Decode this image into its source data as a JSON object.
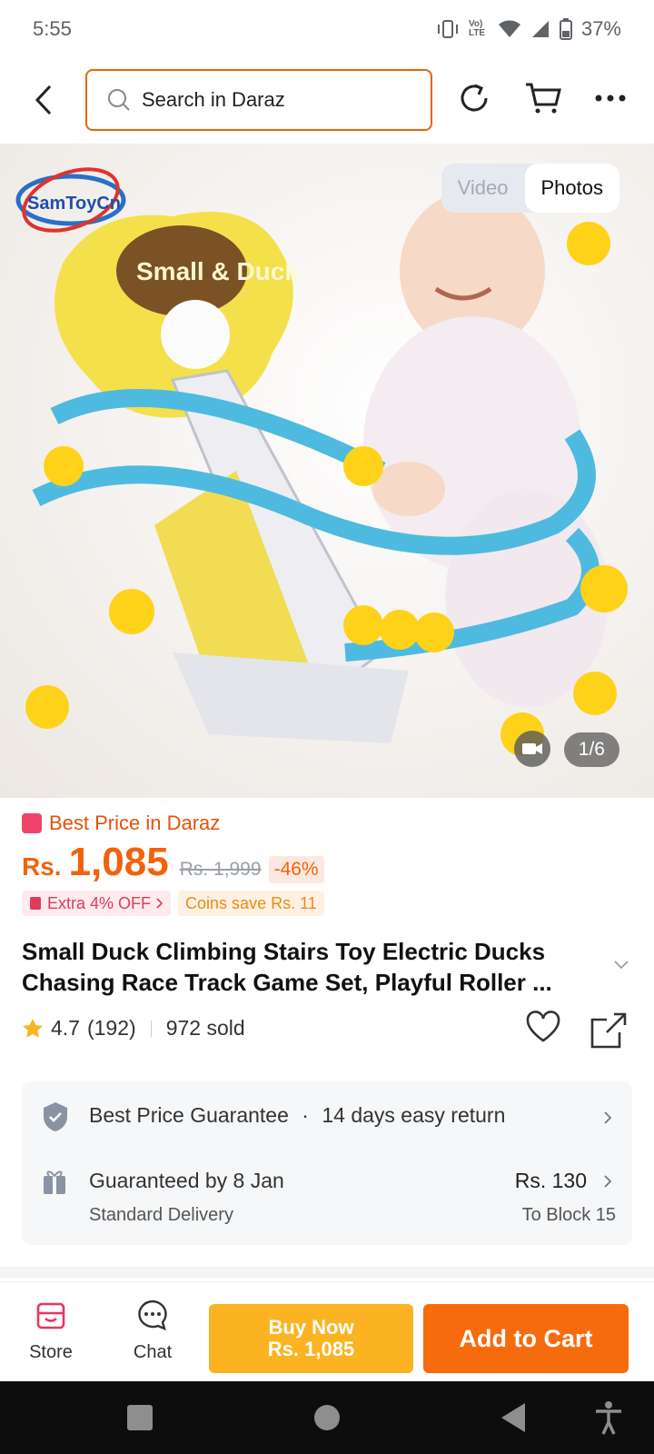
{
  "status": {
    "time": "5:55",
    "battery": "37%",
    "lte_label": "Vo) LTE"
  },
  "header": {
    "search_placeholder": "Search in Daraz"
  },
  "hero": {
    "brand_logo": "SamToyCn",
    "product_box_text": "Small & Duck",
    "toggle": {
      "video": "Video",
      "photos": "Photos",
      "selected": "Photos"
    },
    "counter": "1/6"
  },
  "price": {
    "best_price_label": "Best Price in Daraz",
    "currency": "Rs.",
    "amount": "1,085",
    "original": "Rs. 1,999",
    "discount": "-46%",
    "promo_extra": "Extra 4% OFF",
    "promo_coins": "Coins save Rs. 11"
  },
  "product": {
    "title": "Small Duck Climbing Stairs Toy Electric Ducks Chasing Race Track Game Set, Playful Roller ...",
    "rating": "4.7",
    "reviews": "(192)",
    "sold": "972 sold"
  },
  "service": {
    "guarantee": "Best Price Guarantee",
    "dot": "·",
    "returns": "14 days easy return",
    "delivery_title": "Guaranteed by 8 Jan",
    "delivery_sub": "Standard Delivery",
    "delivery_price": "Rs. 130",
    "delivery_to": "To Block 15"
  },
  "actions": {
    "store": "Store",
    "chat": "Chat",
    "buy_now_line1": "Buy Now",
    "buy_now_line2": "Rs. 1,085",
    "add_to_cart": "Add to Cart"
  },
  "colors": {
    "accent": "#f66b0d",
    "buy": "#fbb321",
    "price": "#f2620c"
  }
}
